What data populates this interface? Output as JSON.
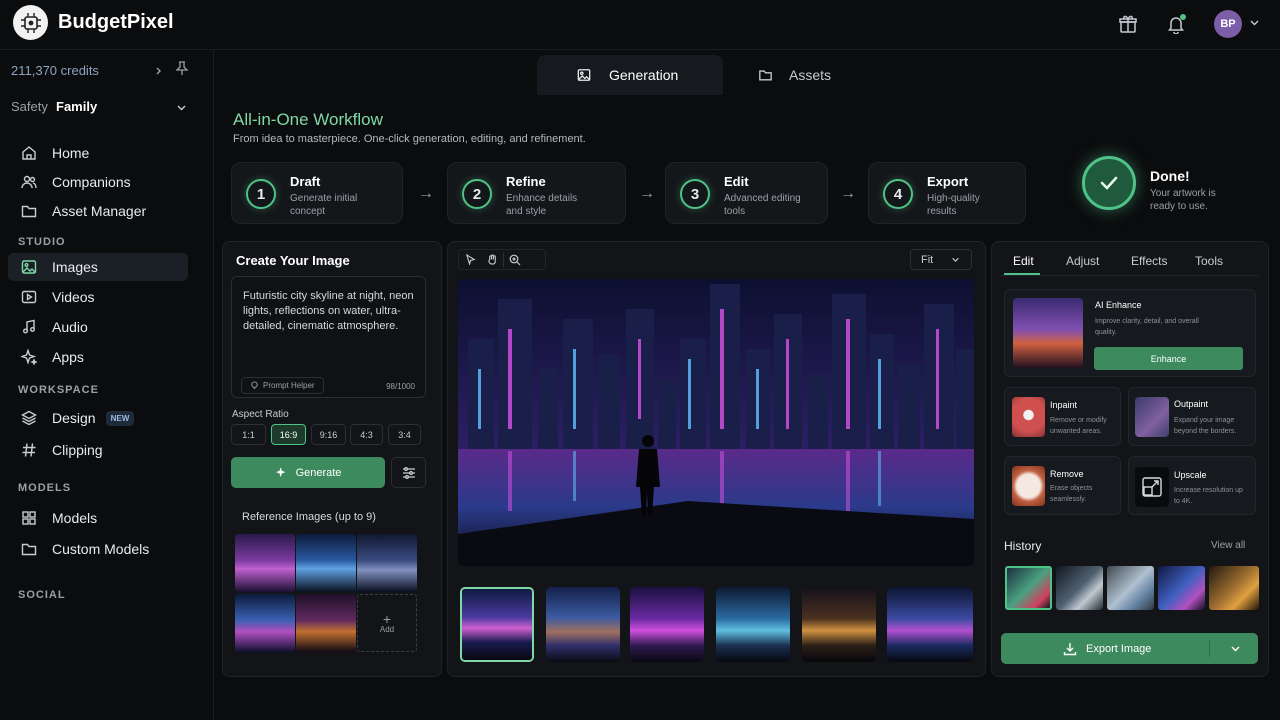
{
  "app": {
    "brand": "BudgetPixel",
    "logo_icon": "ai-chip-logo"
  },
  "header": {
    "gift_icon": "gift-icon",
    "bell_icon": "bell-icon",
    "avatar_initials": "BP"
  },
  "sidebar": {
    "credits": "211,370 credits",
    "safety_label": "Safety",
    "safety_value": "Family",
    "nav_main": [
      {
        "label": "Home",
        "icon": "home-icon"
      },
      {
        "label": "Companions",
        "icon": "users-icon"
      },
      {
        "label": "Asset Manager",
        "icon": "folder-icon"
      }
    ],
    "studio_label": "STUDIO",
    "studio": [
      {
        "label": "Images",
        "icon": "image-icon",
        "active": true
      },
      {
        "label": "Videos",
        "icon": "video-icon"
      },
      {
        "label": "Audio",
        "icon": "music-icon"
      },
      {
        "label": "Apps",
        "icon": "sparkle-icon"
      }
    ],
    "workspace_label": "WORKSPACE",
    "workspace": [
      {
        "label": "Design",
        "icon": "layers-icon",
        "badge": "NEW"
      },
      {
        "label": "Clipping",
        "icon": "hash-icon"
      }
    ],
    "models_label": "MODELS",
    "models": [
      {
        "label": "Models",
        "icon": "grid-icon"
      },
      {
        "label": "Custom Models",
        "icon": "folder-icon"
      }
    ],
    "social_label": "SOCIAL"
  },
  "tabs": [
    {
      "label": "Generation",
      "active": true
    },
    {
      "label": "Assets"
    }
  ],
  "workflow": {
    "title": "All-in-One Workflow",
    "subtitle": "From idea to masterpiece. One-click generation, editing, and refinement.",
    "steps": [
      {
        "num": "1",
        "title": "Draft",
        "desc": "Generate initial concept"
      },
      {
        "num": "2",
        "title": "Refine",
        "desc": "Enhance details and style"
      },
      {
        "num": "3",
        "title": "Edit",
        "desc": "Advanced editing tools"
      },
      {
        "num": "4",
        "title": "Export",
        "desc": "High-quality results"
      }
    ],
    "done_title": "Done!",
    "done_desc": "Your artwork is ready to use."
  },
  "create": {
    "title": "Create Your Image",
    "prompt": "Futuristic city skyline at night, neon lights, reflections on water, ultra-detailed, cinematic atmosphere.",
    "prompt_helper": "Prompt Helper",
    "char_count": "98/1000",
    "aspect_label": "Aspect Ratio",
    "aspects": [
      "1:1",
      "16:9",
      "9:16",
      "4:3",
      "3:4"
    ],
    "aspect_selected": "16:9",
    "generate_label": "Generate",
    "reference_label": "Reference Images (up to 9)",
    "add_label": "Add"
  },
  "canvas": {
    "zoom": "Fit"
  },
  "right": {
    "tabs": [
      "Edit",
      "Adjust",
      "Effects",
      "Tools"
    ],
    "active_tab": "Edit",
    "enhance": {
      "title": "AI Enhance",
      "desc": "Improve clarity, detail, and overall quality.",
      "button": "Enhance"
    },
    "tools": [
      {
        "title": "Inpaint",
        "desc": "Remove or modify unwanted areas."
      },
      {
        "title": "Outpaint",
        "desc": "Expand your image beyond the borders."
      },
      {
        "title": "Remove",
        "desc": "Erase objects seamlessly."
      },
      {
        "title": "Upscale",
        "desc": "Increase resolution up to 4K."
      }
    ],
    "history_label": "History",
    "view_all": "View all",
    "export_label": "Export Image"
  },
  "colors": {
    "accent": "#4fc287",
    "button": "#3d8a5e",
    "bg": "#0b0c0e",
    "panel": "#121417"
  }
}
